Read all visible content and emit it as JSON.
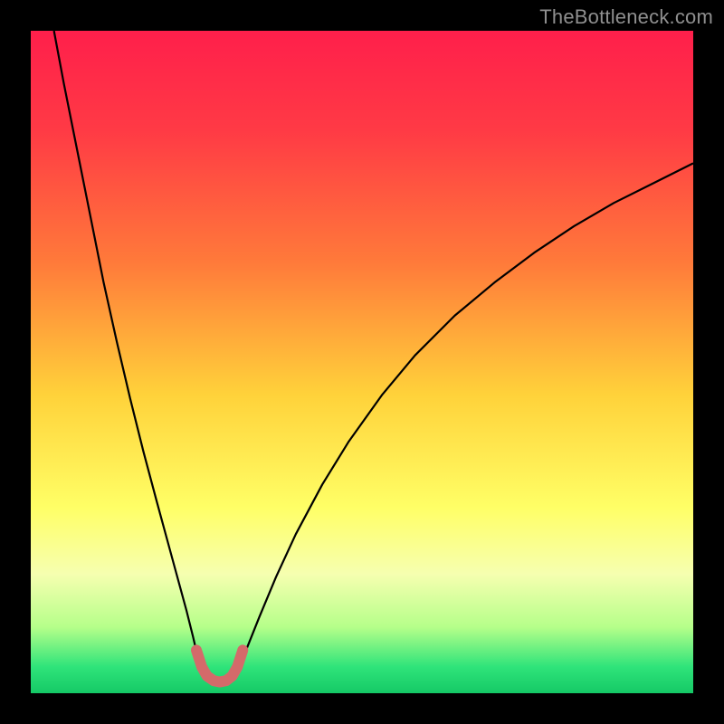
{
  "watermark": "TheBottleneck.com",
  "chart_data": {
    "type": "line",
    "title": "",
    "xlabel": "",
    "ylabel": "",
    "xlim": [
      0,
      100
    ],
    "ylim": [
      0,
      100
    ],
    "gradient_stops": [
      {
        "offset": 0.0,
        "color": "#ff1f4b"
      },
      {
        "offset": 0.15,
        "color": "#ff3a45"
      },
      {
        "offset": 0.35,
        "color": "#ff7a3a"
      },
      {
        "offset": 0.55,
        "color": "#ffd23a"
      },
      {
        "offset": 0.72,
        "color": "#ffff66"
      },
      {
        "offset": 0.82,
        "color": "#f6ffb0"
      },
      {
        "offset": 0.9,
        "color": "#b6ff8a"
      },
      {
        "offset": 0.96,
        "color": "#2fe47a"
      },
      {
        "offset": 1.0,
        "color": "#15c966"
      }
    ],
    "series": [
      {
        "name": "left-curve",
        "stroke": "#000000",
        "width": 2.2,
        "points": [
          {
            "x": 3.5,
            "y": 100.0
          },
          {
            "x": 5.0,
            "y": 92.0
          },
          {
            "x": 7.0,
            "y": 82.0
          },
          {
            "x": 9.0,
            "y": 72.0
          },
          {
            "x": 11.0,
            "y": 62.0
          },
          {
            "x": 13.0,
            "y": 53.0
          },
          {
            "x": 15.0,
            "y": 44.5
          },
          {
            "x": 17.0,
            "y": 36.5
          },
          {
            "x": 19.0,
            "y": 29.0
          },
          {
            "x": 20.5,
            "y": 23.5
          },
          {
            "x": 22.0,
            "y": 18.0
          },
          {
            "x": 23.5,
            "y": 12.5
          },
          {
            "x": 24.5,
            "y": 8.5
          },
          {
            "x": 25.2,
            "y": 5.5
          },
          {
            "x": 25.8,
            "y": 3.8
          }
        ]
      },
      {
        "name": "right-curve",
        "stroke": "#000000",
        "width": 2.2,
        "points": [
          {
            "x": 31.2,
            "y": 3.8
          },
          {
            "x": 32.5,
            "y": 6.5
          },
          {
            "x": 34.5,
            "y": 11.5
          },
          {
            "x": 37.0,
            "y": 17.5
          },
          {
            "x": 40.0,
            "y": 24.0
          },
          {
            "x": 44.0,
            "y": 31.5
          },
          {
            "x": 48.0,
            "y": 38.0
          },
          {
            "x": 53.0,
            "y": 45.0
          },
          {
            "x": 58.0,
            "y": 51.0
          },
          {
            "x": 64.0,
            "y": 57.0
          },
          {
            "x": 70.0,
            "y": 62.0
          },
          {
            "x": 76.0,
            "y": 66.5
          },
          {
            "x": 82.0,
            "y": 70.5
          },
          {
            "x": 88.0,
            "y": 74.0
          },
          {
            "x": 94.0,
            "y": 77.0
          },
          {
            "x": 100.0,
            "y": 80.0
          }
        ]
      },
      {
        "name": "valley-highlight",
        "stroke": "#d46a6a",
        "width": 12,
        "linecap": "round",
        "points": [
          {
            "x": 25.0,
            "y": 6.5
          },
          {
            "x": 25.8,
            "y": 4.0
          },
          {
            "x": 26.6,
            "y": 2.6
          },
          {
            "x": 27.6,
            "y": 1.9
          },
          {
            "x": 28.5,
            "y": 1.7
          },
          {
            "x": 29.5,
            "y": 1.9
          },
          {
            "x": 30.4,
            "y": 2.6
          },
          {
            "x": 31.2,
            "y": 4.0
          },
          {
            "x": 32.0,
            "y": 6.5
          }
        ]
      }
    ]
  }
}
